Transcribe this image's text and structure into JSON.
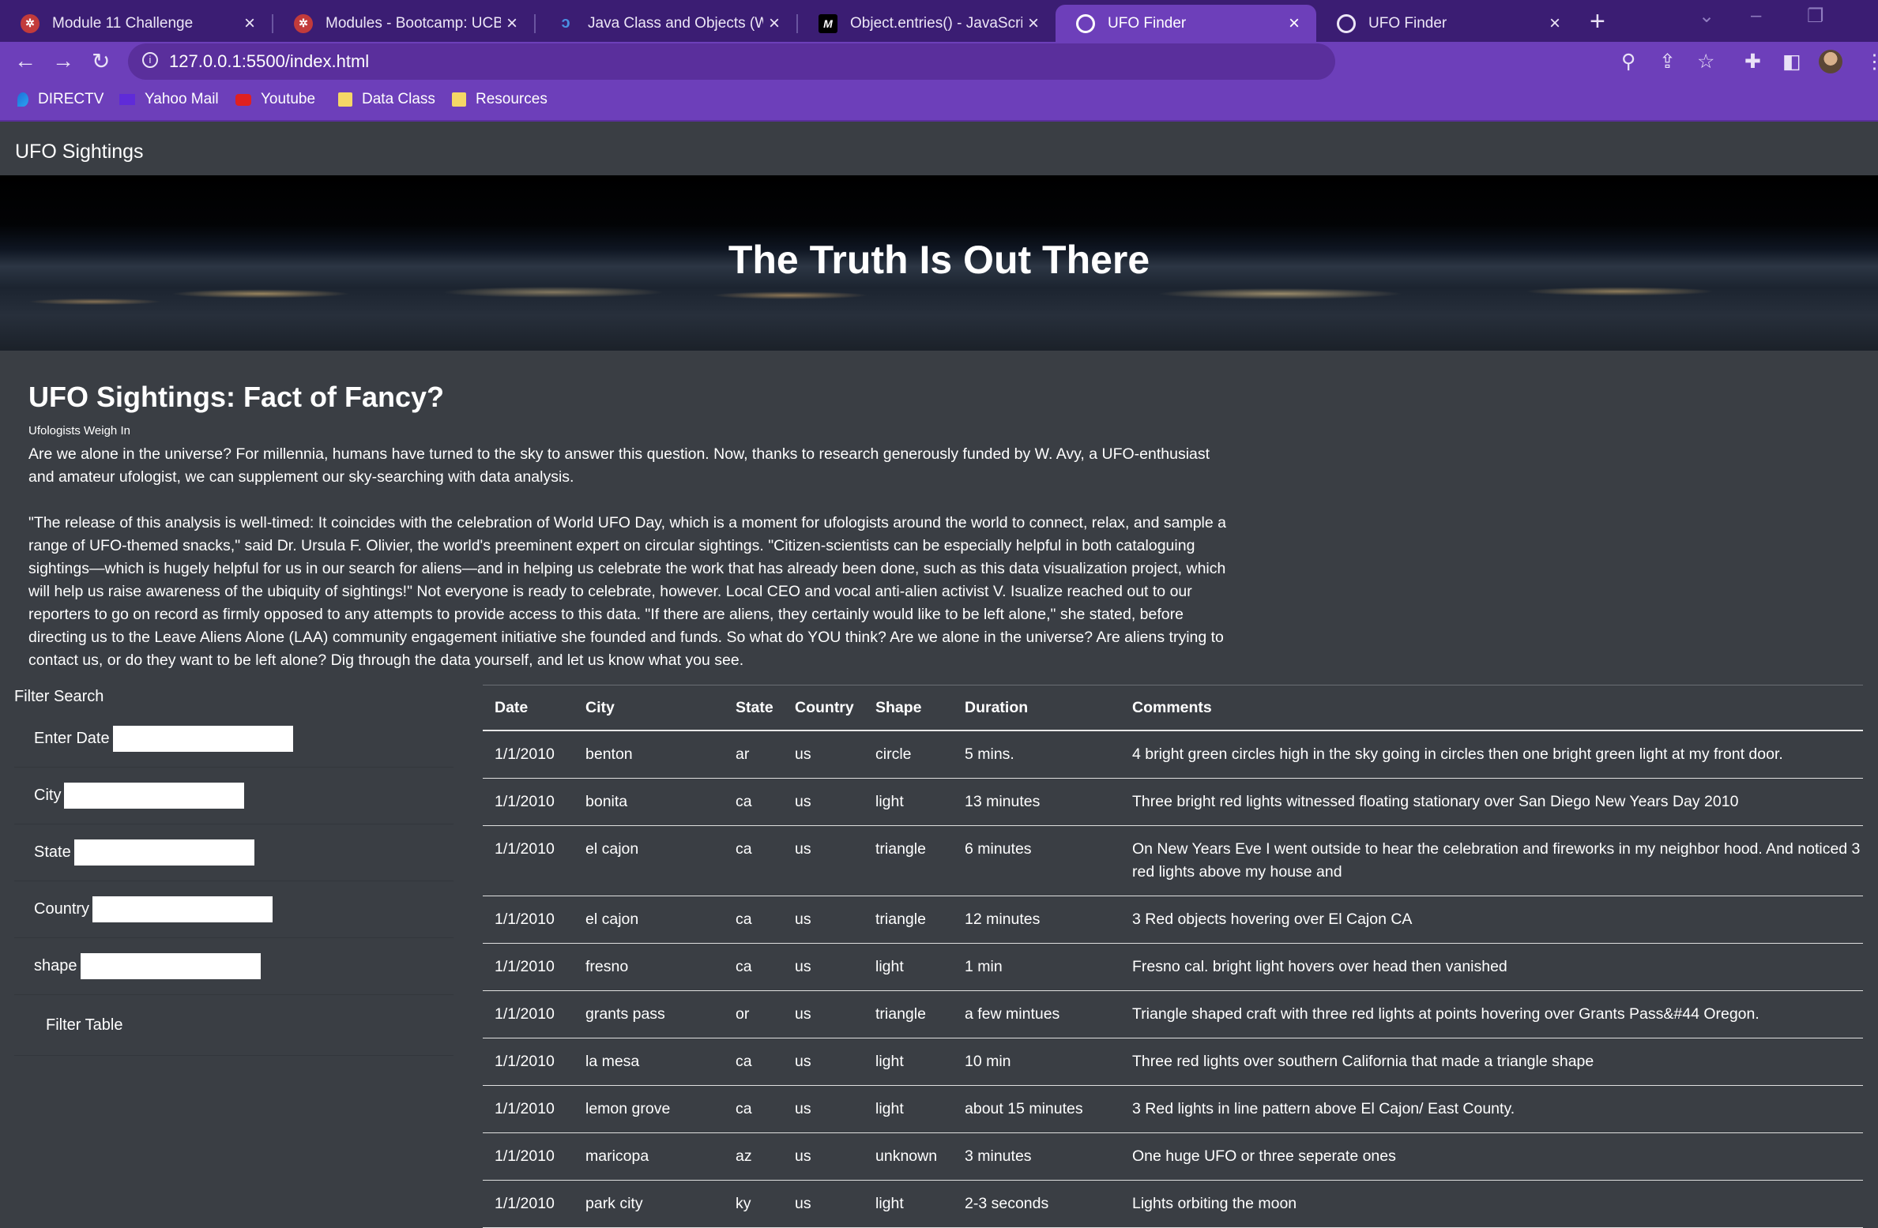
{
  "browser": {
    "tabs": [
      {
        "title": "Module 11 Challenge",
        "active": false
      },
      {
        "title": "Modules - Bootcamp: UCB-VIRT",
        "active": false
      },
      {
        "title": "Java Class and Objects (With Example)",
        "active": false
      },
      {
        "title": "Object.entries() - JavaScript | MDN",
        "active": false
      },
      {
        "title": "UFO Finder",
        "active": true
      },
      {
        "title": "UFO Finder",
        "active": false
      }
    ],
    "url": "127.0.0.1:5500/index.html",
    "bookmarks": [
      "DIRECTV",
      "Yahoo Mail",
      "Youtube",
      "Data Class",
      "Resources"
    ],
    "accent_color": "#6d3fba",
    "tabbar_color": "#3b1d73"
  },
  "page": {
    "brand": "UFO Sightings",
    "hero_title": "The Truth Is Out There",
    "article": {
      "title": "UFO Sightings: Fact of Fancy?",
      "subtitle": "Ufologists Weigh In",
      "paragraph1": "Are we alone in the universe? For millennia, humans have turned to the sky to answer this question. Now, thanks to research generously funded by W. Avy, a UFO-enthusiast and amateur ufologist, we can supplement our sky-searching with data analysis.",
      "paragraph2": "\"The release of this analysis is well-timed: It coincides with the celebration of World UFO Day, which is a moment for ufologists around the world to connect, relax, and sample a range of UFO-themed snacks,\" said Dr. Ursula F. Olivier, the world's preeminent expert on circular sightings. \"Citizen-scientists can be especially helpful in both cataloguing sightings—which is hugely helpful for us in our search for aliens—and in helping us celebrate the work that has already been done, such as this data visualization project, which will help us raise awareness of the ubiquity of sightings!\" Not everyone is ready to celebrate, however. Local CEO and vocal anti-alien activist V. Isualize reached out to our reporters to go on record as firmly opposed to any attempts to provide access to this data. \"If there are aliens, they certainly would like to be left alone,\" she stated, before directing us to the Leave Aliens Alone (LAA) community engagement initiative she founded and funds. So what do YOU think? Are we alone in the universe? Are aliens trying to contact us, or do they want to be left alone? Dig through the data yourself, and let us know what you see."
    },
    "filter": {
      "heading": "Filter Search",
      "fields": [
        {
          "label": "Enter Date",
          "value": ""
        },
        {
          "label": "City",
          "value": ""
        },
        {
          "label": "State",
          "value": ""
        },
        {
          "label": "Country",
          "value": ""
        },
        {
          "label": "shape",
          "value": ""
        }
      ],
      "button_label": "Filter Table"
    },
    "table": {
      "columns": [
        "Date",
        "City",
        "State",
        "Country",
        "Shape",
        "Duration",
        "Comments"
      ],
      "rows": [
        [
          "1/1/2010",
          "benton",
          "ar",
          "us",
          "circle",
          "5 mins.",
          "4 bright green circles high in the sky going in circles then one bright green light at my front door."
        ],
        [
          "1/1/2010",
          "bonita",
          "ca",
          "us",
          "light",
          "13 minutes",
          "Three bright red lights witnessed floating stationary over San Diego New Years Day 2010"
        ],
        [
          "1/1/2010",
          "el cajon",
          "ca",
          "us",
          "triangle",
          "6 minutes",
          "On New Years Eve I went outside to hear the celebration and fireworks in my neighbor hood. And noticed 3 red lights above my house and"
        ],
        [
          "1/1/2010",
          "el cajon",
          "ca",
          "us",
          "triangle",
          "12 minutes",
          "3 Red objects hovering over El Cajon CA"
        ],
        [
          "1/1/2010",
          "fresno",
          "ca",
          "us",
          "light",
          "1 min",
          "Fresno cal. bright light hovers over head then vanished"
        ],
        [
          "1/1/2010",
          "grants pass",
          "or",
          "us",
          "triangle",
          "a few mintues",
          "Triangle shaped craft with three red lights at points hovering over Grants Pass&#44 Oregon."
        ],
        [
          "1/1/2010",
          "la mesa",
          "ca",
          "us",
          "light",
          "10 min",
          "Three red lights over southern California that made a triangle shape"
        ],
        [
          "1/1/2010",
          "lemon grove",
          "ca",
          "us",
          "light",
          "about 15 minutes",
          "3 Red lights in line pattern above El Cajon/ East County."
        ],
        [
          "1/1/2010",
          "maricopa",
          "az",
          "us",
          "unknown",
          "3 minutes",
          "One huge UFO or three seperate ones"
        ],
        [
          "1/1/2010",
          "park city",
          "ky",
          "us",
          "light",
          "2-3 seconds",
          "Lights orbiting the moon"
        ]
      ]
    }
  }
}
